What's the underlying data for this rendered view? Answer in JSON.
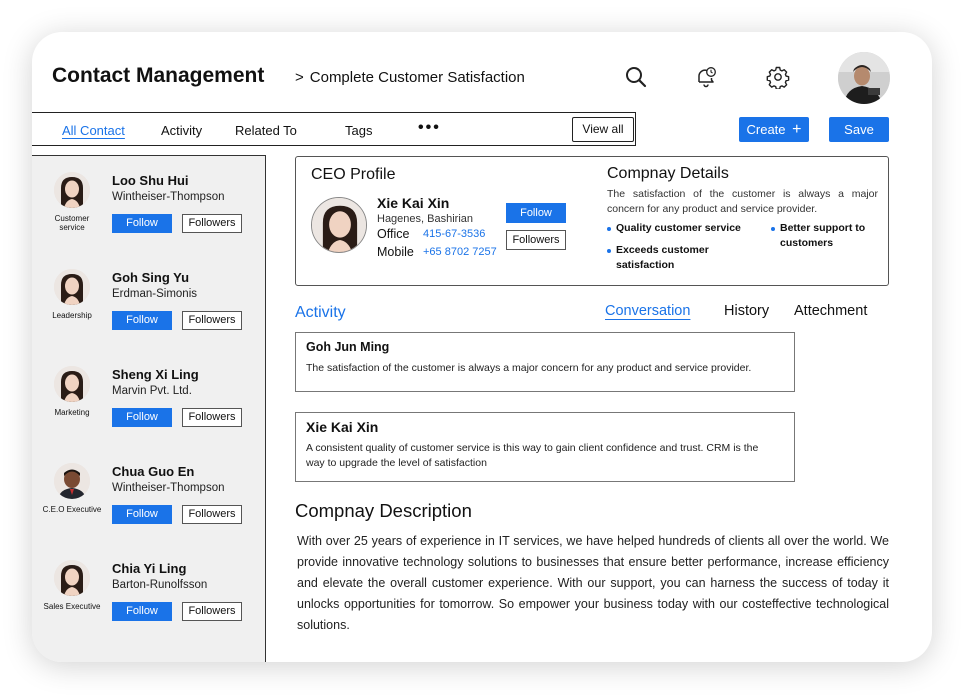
{
  "header": {
    "title": "Contact Management",
    "breadcrumb_sep": ">",
    "breadcrumb": "Complete Customer Satisfaction"
  },
  "tabs": [
    {
      "label": "All Contact",
      "active": true
    },
    {
      "label": "Activity"
    },
    {
      "label": "Related To"
    },
    {
      "label": "Tags"
    }
  ],
  "toolbar": {
    "more": "•••",
    "view_all": "View all",
    "create": "Create",
    "save": "Save"
  },
  "contacts": [
    {
      "name": "Loo Shu Hui",
      "company": "Wintheiser-Thompson",
      "role": "Customer service",
      "follow": "Follow",
      "followers": "Followers"
    },
    {
      "name": "Goh Sing Yu",
      "company": "Erdman-Simonis",
      "role": "Leadership",
      "follow": "Follow",
      "followers": "Followers"
    },
    {
      "name": "Sheng Xi Ling",
      "company": "Marvin Pvt. Ltd.",
      "role": "Marketing",
      "follow": "Follow",
      "followers": "Followers"
    },
    {
      "name": "Chua Guo En",
      "company": "Wintheiser-Thompson",
      "role": "C.E.O Executive",
      "follow": "Follow",
      "followers": "Followers"
    },
    {
      "name": "Chia Yi Ling",
      "company": "Barton-Runolfsson",
      "role": "Sales Executive",
      "follow": "Follow",
      "followers": "Followers"
    }
  ],
  "ceo": {
    "title": "CEO Profile",
    "name": "Xie Kai Xin",
    "location": "Hagenes, Bashirian",
    "office_label": "Office",
    "office": "415-67-3536",
    "mobile_label": "Mobile",
    "mobile": "+65 8702 7257",
    "follow": "Follow",
    "followers": "Followers"
  },
  "company": {
    "title": "Compnay Details",
    "desc": "The satisfaction of the customer is always a major concern for any product and service provider.",
    "bullets": [
      "Quality customer service",
      "Better support to customers",
      "Exceeds customer satisfaction"
    ]
  },
  "activity": {
    "title": "Activity",
    "tabs": [
      "Conversation",
      "History",
      "Attechment"
    ],
    "messages": [
      {
        "name": "Goh Jun Ming",
        "text": "The satisfaction of the customer is always a major concern for any product and service provider."
      },
      {
        "name": "Xie Kai Xin",
        "text": "A consistent quality of customer service is this way to gain client confidence and trust. CRM is the way to upgrade the level of satisfaction"
      }
    ]
  },
  "description": {
    "title": "Compnay Description",
    "body": "With over 25 years of experience in IT services, we have helped hundreds of clients all over the world. We provide innovative technology solutions to businesses that ensure better performance, increase efficiency and elevate the overall customer experience. With our support, you can harness the success of today it unlocks opportunities for tomorrow. So empower your business today with our costeffective technological solutions."
  },
  "colors": {
    "accent": "#1a73e8",
    "sidebar_bg": "#f0f0f0"
  }
}
